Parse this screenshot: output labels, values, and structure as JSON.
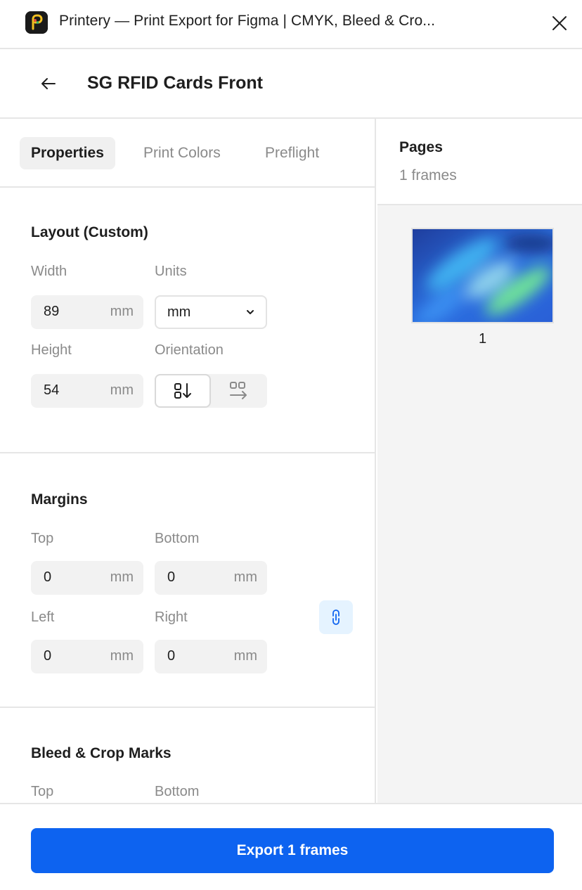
{
  "window": {
    "title": "Printery — Print Export for Figma | CMYK, Bleed & Cro...",
    "icons": {
      "app": "printery-logo",
      "close": "close-icon"
    }
  },
  "header": {
    "title": "SG RFID Cards Front",
    "back_icon": "arrow-left-icon"
  },
  "tabs": [
    {
      "label": "Properties",
      "active": true
    },
    {
      "label": "Print Colors",
      "active": false
    },
    {
      "label": "Preflight",
      "active": false
    }
  ],
  "layout": {
    "title": "Layout (Custom)",
    "width_label": "Width",
    "width_value": "89",
    "width_unit": "mm",
    "units_label": "Units",
    "units_value": "mm",
    "height_label": "Height",
    "height_value": "54",
    "height_unit": "mm",
    "orientation_label": "Orientation",
    "orientation_selected": "portrait"
  },
  "margins": {
    "title": "Margins",
    "top_label": "Top",
    "top_value": "0",
    "top_unit": "mm",
    "bottom_label": "Bottom",
    "bottom_value": "0",
    "bottom_unit": "mm",
    "left_label": "Left",
    "left_value": "0",
    "left_unit": "mm",
    "right_label": "Right",
    "right_value": "0",
    "right_unit": "mm",
    "link_icon": "link-icon"
  },
  "bleed": {
    "title": "Bleed & Crop Marks",
    "top_label": "Top",
    "bottom_label": "Bottom"
  },
  "pages": {
    "title": "Pages",
    "count": "1 frames",
    "items": [
      {
        "label": "1"
      }
    ]
  },
  "footer": {
    "export_label": "Export 1 frames"
  },
  "colors": {
    "accent": "#0d63f0",
    "link_bg": "#e5f3ff"
  }
}
